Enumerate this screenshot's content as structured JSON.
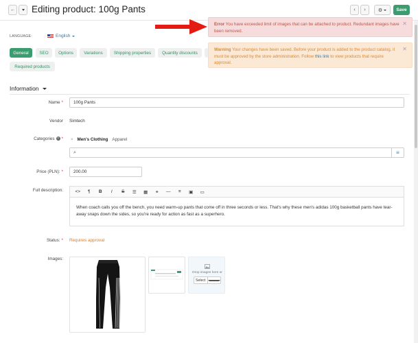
{
  "header": {
    "title": "Editing product: 100g Pants",
    "save_label": "Save",
    "back_icon": "←",
    "settings_icon": "⚙"
  },
  "language": {
    "label": "LANGUAGE:",
    "value": "English"
  },
  "tabs": [
    {
      "label": "General",
      "active": true
    },
    {
      "label": "SEO"
    },
    {
      "label": "Options"
    },
    {
      "label": "Variations"
    },
    {
      "label": "Shipping properties"
    },
    {
      "label": "Quantity discounts"
    },
    {
      "label": "Required products"
    }
  ],
  "notifications": {
    "error": {
      "title": "Error",
      "text": "You have exceeded limit of images that can be attached to product. Redundant images have been removed."
    },
    "warning": {
      "title": "Warning",
      "text_before": "Your changes have been saved. Before your product is added to the product catalog, it must be approved by the store administration. Follow",
      "link": "this link",
      "text_after": "to view products that require approval."
    }
  },
  "section": {
    "title": "Information"
  },
  "fields": {
    "name_label": "Name",
    "name_value": "100g Pants",
    "vendor_label": "Vendor",
    "vendor_value": "Simtech",
    "categories_label": "Categories",
    "category_main": "Men's Clothing",
    "category_sub": "Apparel",
    "price_label": "Price (PLN):",
    "price_value": "200.00",
    "description_label": "Full description:",
    "description_text": "When coach calls you off the bench, you need warm-up pants that come off in three seconds or less. That's why these men's adidas 100g basketball pants have tear-away snaps down the sides, so you're ready for action as fast as a superhero.",
    "status_label": "Status:",
    "status_value": "Requires approval",
    "images_label": "Images:",
    "dropzone_text": "Drop images here or",
    "select_label": "Select"
  },
  "colors": {
    "accent": "#3a9c6f",
    "error_bg": "#f6dcdc",
    "warning_bg": "#fbe8d5",
    "status_orange": "#e07b22"
  }
}
